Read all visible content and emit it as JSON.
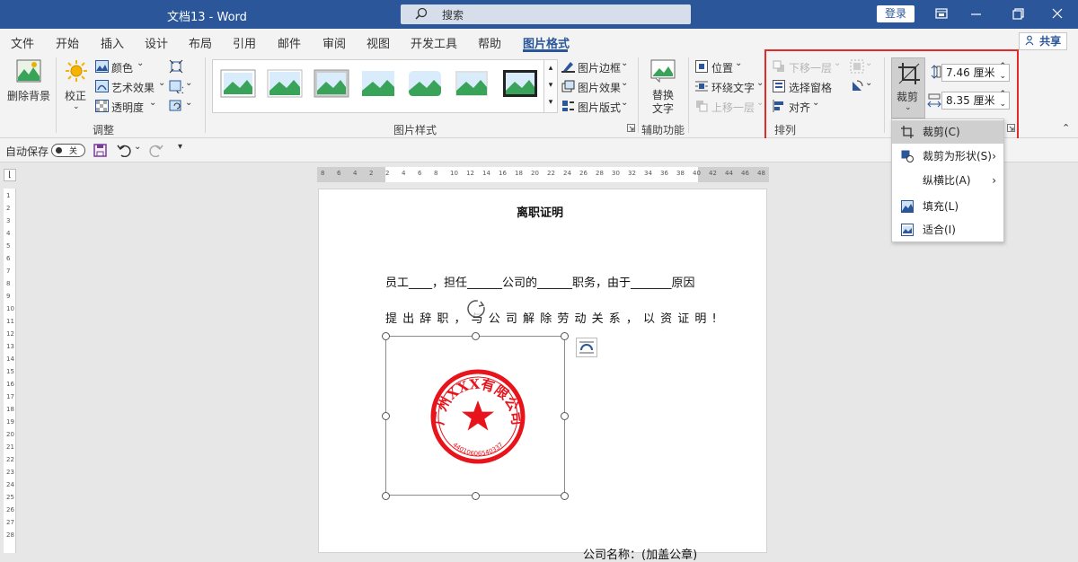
{
  "title": "文档13  -  Word",
  "search": {
    "placeholder": "搜索"
  },
  "account": {
    "login": "登录"
  },
  "tabs": [
    "文件",
    "开始",
    "插入",
    "设计",
    "布局",
    "引用",
    "邮件",
    "审阅",
    "视图",
    "开发工具",
    "帮助",
    "图片格式"
  ],
  "share": "共享",
  "ribbon": {
    "remove_bg": "删除背景",
    "correct": "校正",
    "color": "颜色",
    "art_effect": "艺术效果",
    "transparency": "透明度",
    "group_adjust": "调整",
    "group_styles": "图片样式",
    "border": "图片边框",
    "effect": "图片效果",
    "layout": "图片版式",
    "alt_text_1": "替换",
    "alt_text_2": "文字",
    "group_access": "辅助功能",
    "position": "位置",
    "wrap": "环绕文字",
    "bring_forward": "上移一层",
    "send_backward": "下移一层",
    "selection_pane": "选择窗格",
    "align": "对齐",
    "group_arrange": "排列",
    "crop": "裁剪",
    "height": "7.46 厘米",
    "width": "8.35 厘米"
  },
  "qat": {
    "autosave": "自动保存",
    "autosave_state": "关"
  },
  "ruler_numbers": [
    "8",
    "6",
    "4",
    "2",
    "2",
    "4",
    "6",
    "8",
    "10",
    "12",
    "14",
    "16",
    "18",
    "20",
    "22",
    "24",
    "26",
    "28",
    "30",
    "32",
    "34",
    "36",
    "38",
    "40",
    "42",
    "44",
    "46",
    "48"
  ],
  "vruler_numbers": [
    "1",
    "2",
    "3",
    "4",
    "5",
    "6",
    "7",
    "8",
    "9",
    "10",
    "11",
    "12",
    "13",
    "14",
    "15",
    "16",
    "17",
    "18",
    "19",
    "20",
    "21",
    "22",
    "23",
    "24",
    "25",
    "26",
    "27",
    "28"
  ],
  "document": {
    "heading": "离职证明",
    "line1": "员工____，担任______公司的______职务，由于_______原因",
    "line2": "提 出 辞 职 ， 与 公 司 解 除 劳 动 关 系 ， 以 资 证 明 !",
    "company": "公司名称：(加盖公章)",
    "seal_text": "广州XXX有限公司",
    "seal_number": "44010606540337"
  },
  "crop_menu": [
    {
      "label": "裁剪(C)",
      "highlighted": true
    },
    {
      "label": "裁剪为形状(S)",
      "submenu": true
    },
    {
      "label": "纵横比(A)",
      "submenu": true
    },
    {
      "label": "填充(L)"
    },
    {
      "label": "适合(I)"
    }
  ],
  "colors": {
    "titlebar": "#2b579a",
    "accent": "#2b579a",
    "seal": "#e8141c",
    "highlight_box": "#e02b2b"
  }
}
